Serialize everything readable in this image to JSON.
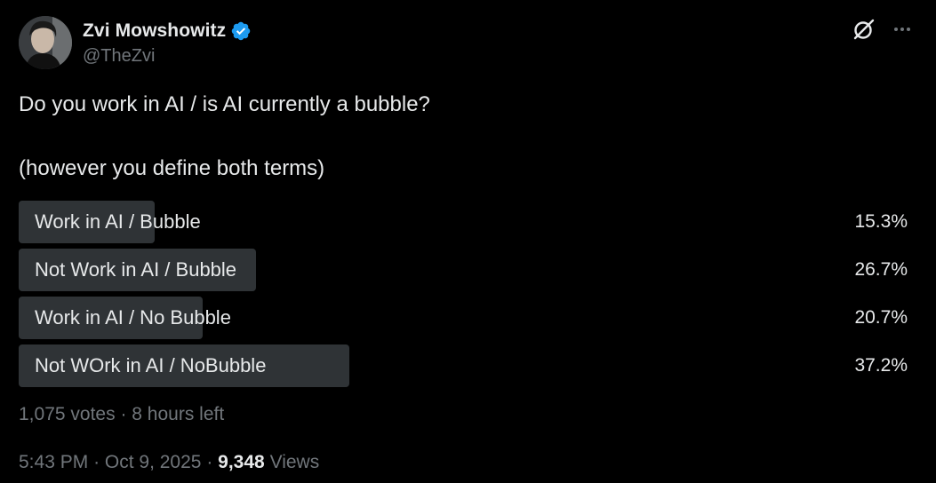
{
  "author": {
    "display_name": "Zvi Mowshowitz",
    "handle": "@TheZvi",
    "verified": true,
    "verified_color": "#1d9bf0"
  },
  "tweet": {
    "line1": "Do you work in AI / is AI currently a bubble?",
    "line2": "(however you define both terms)"
  },
  "poll": {
    "options": [
      {
        "label": "Work in AI / Bubble",
        "percent": "15.3%",
        "value": 15.3
      },
      {
        "label": "Not Work in AI / Bubble",
        "percent": "26.7%",
        "value": 26.7
      },
      {
        "label": "Work in AI / No Bubble",
        "percent": "20.7%",
        "value": 20.7
      },
      {
        "label": "Not WOrk in AI / NoBubble",
        "percent": "37.2%",
        "value": 37.2
      }
    ],
    "votes": "1,075 votes",
    "separator": "·",
    "time_left": "8 hours left"
  },
  "meta": {
    "time": "5:43 PM",
    "separator": "·",
    "date": "Oct 9, 2025",
    "views_count": "9,348",
    "views_label": "Views"
  },
  "icons": {
    "grok": "grok-icon",
    "more": "more-icon",
    "verified": "verified-badge-icon"
  },
  "colors": {
    "background": "#000000",
    "text": "#e7e9ea",
    "secondary_text": "#71767b",
    "poll_bar": "#2f3336"
  }
}
